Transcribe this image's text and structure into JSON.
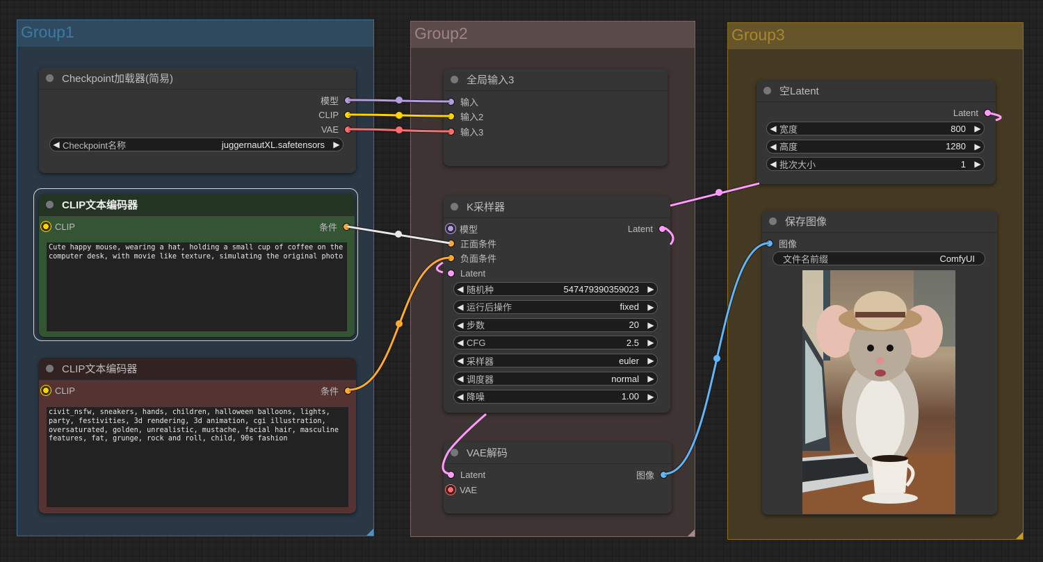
{
  "groups": [
    {
      "title": "Group1"
    },
    {
      "title": "Group2"
    },
    {
      "title": "Group3"
    }
  ],
  "colors": {
    "model": "#b39ddb",
    "clip": "#ffd500",
    "vae": "#ff6e6e",
    "conditioning": "#ffa931",
    "latent": "#ff9cf9",
    "image": "#64b5f6",
    "selected_link": "#e8e8e8"
  },
  "nodes": {
    "checkpoint_loader": {
      "title": "Checkpoint加载器(简易)",
      "outputs": [
        "模型",
        "CLIP",
        "VAE"
      ],
      "widget": {
        "label": "Checkpoint名称",
        "value": "juggernautXL.safetensors"
      }
    },
    "clip_positive": {
      "title": "CLIP文本编码器",
      "input": "CLIP",
      "output": "条件",
      "text": "Cute happy mouse, wearing a hat, holding a small cup of coffee on the computer desk, with movie like texture, simulating the original photo"
    },
    "clip_negative": {
      "title": "CLIP文本编码器",
      "input": "CLIP",
      "output": "条件",
      "text": "civit_nsfw, sneakers, hands, children, halloween balloons, lights, party, festivities, 3d rendering, 3d animation, cgi illustration, oversaturated, golden, unrealistic, mustache, facial hair, masculine features, fat, grunge, rock and roll, child, 90s fashion"
    },
    "global_input": {
      "title": "全局输入3",
      "inputs": [
        "输入",
        "输入2",
        "输入3"
      ]
    },
    "ksampler": {
      "title": "K采样器",
      "inputs": [
        "模型",
        "正面条件",
        "负面条件",
        "Latent"
      ],
      "output": "Latent",
      "widgets": [
        {
          "label": "随机种",
          "value": "547479390359023"
        },
        {
          "label": "运行后操作",
          "value": "fixed"
        },
        {
          "label": "步数",
          "value": "20"
        },
        {
          "label": "CFG",
          "value": "2.5"
        },
        {
          "label": "采样器",
          "value": "euler"
        },
        {
          "label": "调度器",
          "value": "normal"
        },
        {
          "label": "降噪",
          "value": "1.00"
        }
      ]
    },
    "vae_decode": {
      "title": "VAE解码",
      "inputs": [
        "Latent",
        "VAE"
      ],
      "output": "图像"
    },
    "empty_latent": {
      "title": "空Latent",
      "output": "Latent",
      "widgets": [
        {
          "label": "宽度",
          "value": "800"
        },
        {
          "label": "高度",
          "value": "1280"
        },
        {
          "label": "批次大小",
          "value": "1"
        }
      ]
    },
    "save_image": {
      "title": "保存图像",
      "input": "图像",
      "widget": {
        "label": "文件名前缀",
        "value": "ComfyUI"
      },
      "preview": "mouse-with-hat-and-coffee-image"
    }
  },
  "arrows": {
    "left": "◀",
    "right": "▶"
  }
}
